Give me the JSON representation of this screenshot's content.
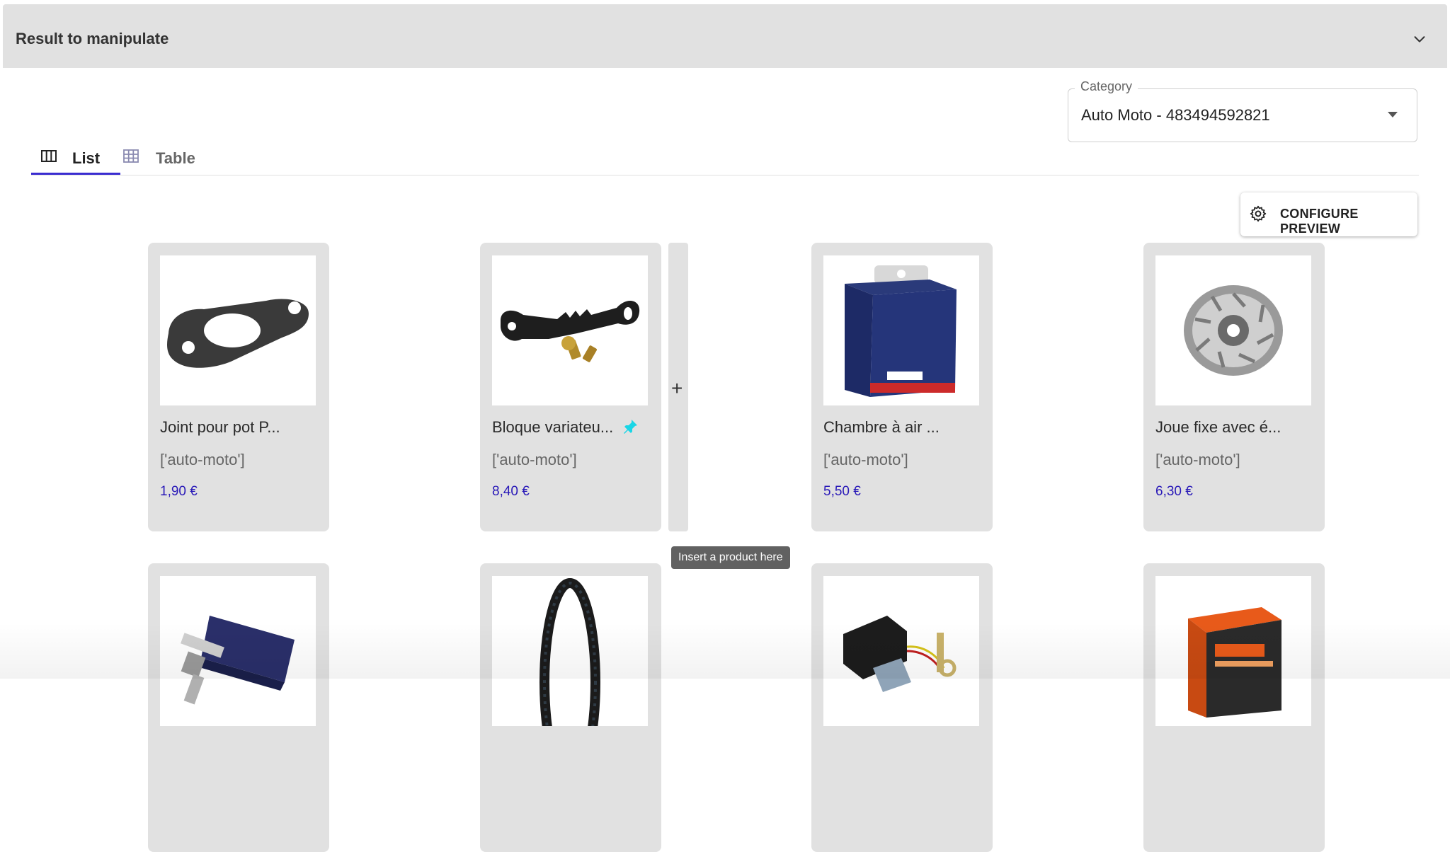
{
  "panel": {
    "title": "Result to manipulate",
    "collapse_icon": "chevron-down-icon"
  },
  "category": {
    "label": "Category",
    "value": "Auto Moto - 483494592821"
  },
  "tabs": [
    {
      "label": "List",
      "icon": "columns-icon",
      "active": true
    },
    {
      "label": "Table",
      "icon": "grid-icon",
      "active": false
    }
  ],
  "toolbar": {
    "configure_label": "CONFIGURE PREVIEW",
    "configure_icon": "gear-icon"
  },
  "products": [
    {
      "name": "Joint pour pot P...",
      "tags": "['auto-moto']",
      "price": "1,90 €",
      "image": "gasket",
      "pinned": false
    },
    {
      "name": "Bloque variateu...",
      "tags": "['auto-moto']",
      "price": "8,40 €",
      "image": "bracket",
      "pinned": true
    },
    {
      "name": "Chambre à air ...",
      "tags": "['auto-moto']",
      "price": "5,50 €",
      "image": "inner-tube-box",
      "pinned": false
    },
    {
      "name": "Joue fixe avec é...",
      "tags": "['auto-moto']",
      "price": "6,30 €",
      "image": "fan-wheel",
      "pinned": false
    },
    {
      "name": "",
      "tags": "",
      "price": "",
      "image": "spark-plug",
      "pinned": false
    },
    {
      "name": "",
      "tags": "",
      "price": "",
      "image": "tire",
      "pinned": false
    },
    {
      "name": "",
      "tags": "",
      "price": "",
      "image": "regulator",
      "pinned": false
    },
    {
      "name": "",
      "tags": "",
      "price": "",
      "image": "battery-box",
      "pinned": false
    }
  ],
  "insert": {
    "plus": "+",
    "tooltip": "Insert a product here"
  },
  "colors": {
    "accent": "#3a2cd0",
    "price": "#2a1ab8",
    "card_bg": "#e1e1e1",
    "pin": "#1ad6e6"
  }
}
